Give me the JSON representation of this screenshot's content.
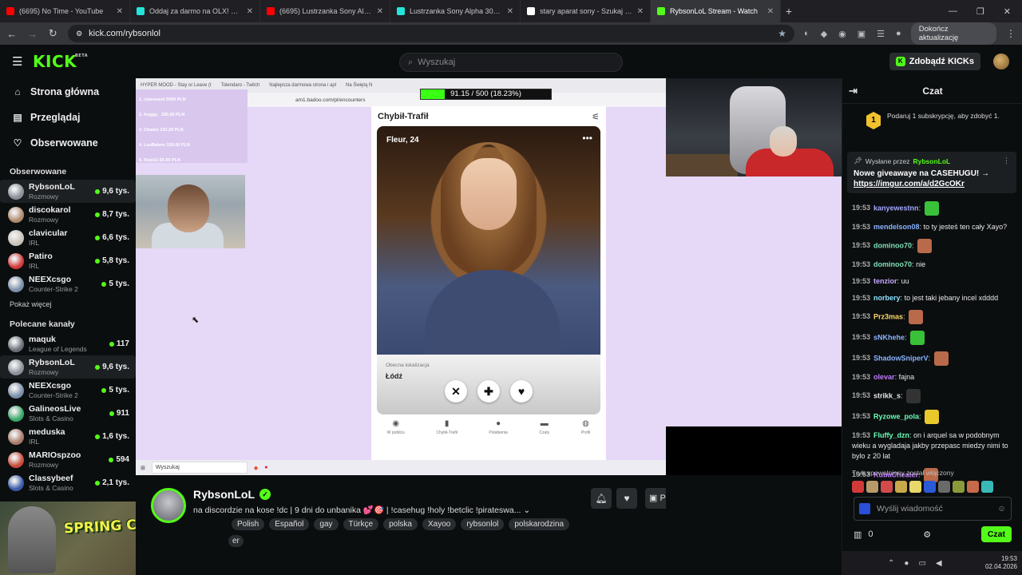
{
  "browser": {
    "tabs": [
      {
        "title": "(6695) No Time - YouTube",
        "color": "#ff0000"
      },
      {
        "title": "Oddaj za darmo na OLX! Dodaj",
        "color": "#23e5db"
      },
      {
        "title": "(6695) Lustrzanka Sony Alpha 3",
        "color": "#ff0000"
      },
      {
        "title": "Lustrzanka Sony Alpha 300 | Ol",
        "color": "#23e5db"
      },
      {
        "title": "stary aparat sony - Szukaj w Go",
        "color": "#ffffff"
      },
      {
        "title": "RybsonLoL Stream - Watch",
        "color": "#53fc18"
      }
    ],
    "url": "kick.com/rybsonlol",
    "update_label": "Dokończ aktualizację"
  },
  "kick": {
    "logo": "KICK",
    "logo_badge": "BETA",
    "search_placeholder": "Wyszukaj",
    "kicks_button": "Zdobądź KICKs"
  },
  "sidebar": {
    "nav": [
      {
        "label": "Strona główna",
        "icon": "home-icon"
      },
      {
        "label": "Przeglądaj",
        "icon": "browse-icon"
      },
      {
        "label": "Obserwowane",
        "icon": "heart-icon"
      }
    ],
    "followed_heading": "Obserwowane",
    "followed": [
      {
        "name": "RybsonLoL",
        "category": "Rozmowy",
        "viewers": "9,6 tys.",
        "color": "#8a8f99",
        "selected": true
      },
      {
        "name": "discokarol",
        "category": "Rozmowy",
        "viewers": "8,7 tys.",
        "color": "#b08a6a",
        "selected": false
      },
      {
        "name": "clavicular",
        "category": "IRL",
        "viewers": "6,6 tys.",
        "color": "#c9c2b8",
        "selected": false
      },
      {
        "name": "Patiro",
        "category": "IRL",
        "viewers": "5,8 tys.",
        "color": "#d23a3a",
        "selected": false
      },
      {
        "name": "NEEXcsgo",
        "category": "Counter-Strike 2",
        "viewers": "5 tys.",
        "color": "#7a8ea8",
        "selected": false
      }
    ],
    "show_more": "Pokaż więcej",
    "recommended_heading": "Polecane kanały",
    "recommended": [
      {
        "name": "maquk",
        "category": "League of Legends",
        "viewers": "117",
        "color": "#6a6f79",
        "selected": false
      },
      {
        "name": "RybsonLoL",
        "category": "Rozmowy",
        "viewers": "9,6 tys.",
        "color": "#8a8f99",
        "selected": true
      },
      {
        "name": "NEEXcsgo",
        "category": "Counter-Strike 2",
        "viewers": "5 tys.",
        "color": "#7a8ea8",
        "selected": false
      },
      {
        "name": "GalineosLive",
        "category": "Slots & Casino",
        "viewers": "911",
        "color": "#3aa86a",
        "selected": false
      },
      {
        "name": "meduska",
        "category": "IRL",
        "viewers": "1,6 tys.",
        "color": "#a87a6a",
        "selected": false
      },
      {
        "name": "MARIOspzoo",
        "category": "Rozmowy",
        "viewers": "594",
        "color": "#c84a3a",
        "selected": false
      },
      {
        "name": "Classybeef",
        "category": "Slots & Casino",
        "viewers": "2,1 tys.",
        "color": "#3a5aa8",
        "selected": false
      }
    ]
  },
  "promo": {
    "text": "SPRING CLEANUP"
  },
  "video": {
    "browser_tabs": [
      "HYPER MOOD - Stay or Leave (t",
      "Tolendaro - Twitch",
      "Najlepsza darmowa strona i apl",
      "Na Świętą N"
    ],
    "url": "am1.badoo.com/pl/encounters",
    "goal_text": "91.15 / 500 (18.23%)",
    "goal_fraction": 0.1823,
    "donations": [
      "1. rybsonsol 5000 PLN",
      "2. froggy_ 365.00 PLN",
      "3. Chamo 132.29 PLN",
      "4. LosBahno 150.00 PLN",
      "5. Rojo11 65.00 PLN"
    ],
    "app_title": "Chybił-Trafił",
    "profile_name": "Fleur, 24",
    "location_label": "Obecna lokalizacja",
    "location_value": "Łódź",
    "bottom_nav": [
      "W pobliżu",
      "Chybił-Trafił",
      "Polubienia",
      "Czaty",
      "Profil"
    ],
    "taskbar_search": "Wyszukaj"
  },
  "stream": {
    "name": "RybsonLoL",
    "title": "na discordzie na kose !dc | 9 dni do unbanika 💕🎯 | !casehug !holy !betclic !pirateswa...",
    "tags": [
      "Polish",
      "Español",
      "gay",
      "Türkçe",
      "polska",
      "Xayoo",
      "rybsonlol",
      "polskarodzina"
    ],
    "tag_overflow": "er",
    "sub_label": "P"
  },
  "chat": {
    "title": "Czat",
    "sub_goal_count": "1",
    "sub_goal_text": "Podaruj 1 subskrypcję, aby zdobyć 1.",
    "pinned_by_label": "Wysłane przez",
    "pinned_by": "RybsonLoL",
    "pinned_text": "Nowe giveawaye na CASEHUGU! →",
    "pinned_link": "https://imgur.com/a/d2GcOKr",
    "messages": [
      {
        "time": "19:53",
        "user": "kanyewestnn",
        "color": "#a4a6ff",
        "text": "",
        "emote": "#3ac13a"
      },
      {
        "time": "19:53",
        "user": "mendelson08",
        "color": "#8ab4ff",
        "text": "to ty jesteś ten cały Xayo?",
        "emote": ""
      },
      {
        "time": "19:53",
        "user": "dominoo70",
        "color": "#7ee0b8",
        "text": "",
        "emote": "#b86a4a"
      },
      {
        "time": "19:53",
        "user": "dominoo70",
        "color": "#7ee0b8",
        "text": "nie",
        "emote": ""
      },
      {
        "time": "19:53",
        "user": "tenzior",
        "color": "#c8a8ff",
        "text": "uu",
        "emote": ""
      },
      {
        "time": "19:53",
        "user": "norbery",
        "color": "#8ae0ff",
        "text": "to jest taki jebany incel xdddd",
        "emote": ""
      },
      {
        "time": "19:53",
        "user": "Prz3mas",
        "color": "#ffd86a",
        "text": "",
        "emote": "#b86a4a"
      },
      {
        "time": "19:53",
        "user": "sNKhehe",
        "color": "#8ab4ff",
        "text": "",
        "emote": "#3ac13a"
      },
      {
        "time": "19:53",
        "user": "ShadowSniperV",
        "color": "#8ab4ff",
        "text": "",
        "emote": "#b86a4a"
      },
      {
        "time": "19:53",
        "user": "olevar",
        "color": "#c07aff",
        "text": "fajna",
        "emote": ""
      },
      {
        "time": "19:53",
        "user": "strikk_s",
        "color": "#e8e8e8",
        "text": "",
        "emote": "#333333"
      },
      {
        "time": "19:53",
        "user": "Ryzowe_pola",
        "color": "#6affb8",
        "text": "",
        "emote": "#e8c82a"
      },
      {
        "time": "19:53",
        "user": "Fluffy_dzn",
        "color": "#6affb8",
        "text": "on i arquel sa w podobnym wieku a wygladaja jakby przepasc miedzy nimi to bylo z 20 lat",
        "emote": ""
      },
      {
        "time": "19:53",
        "user": "KubaCheater",
        "color": "#c07aff",
        "text": "",
        "emote": "#b86a4a"
      }
    ],
    "slow_mode": "Tryb spowolniony został włączony",
    "emote_row": [
      "#d23a3a",
      "#b89a6a",
      "#d24a4a",
      "#c8a84a",
      "#e8d86a",
      "#2a5ad8",
      "#6a6a6a",
      "#8a9a3a",
      "#c86a4a",
      "#3ab8b8"
    ],
    "input_placeholder": "Wyślij wiadomość",
    "points": "0",
    "send_label": "Czat"
  },
  "os": {
    "time": "19:53",
    "date": "02.04.2026"
  }
}
